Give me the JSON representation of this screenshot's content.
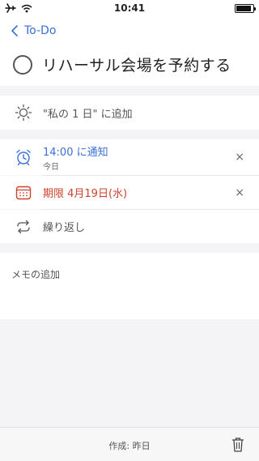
{
  "status_bar": {
    "time": "10:41"
  },
  "header": {
    "back_label": "To-Do"
  },
  "task": {
    "title": "リハーサル会場を予約する"
  },
  "my_day": {
    "label": "\"私の 1 日\" に追加"
  },
  "reminder": {
    "title": "14:00 に通知",
    "subtitle": "今日",
    "color": "#3a6fd8"
  },
  "due": {
    "title": "期限 4月19日(水)",
    "color": "#d0412b"
  },
  "repeat": {
    "label": "繰り返し"
  },
  "notes": {
    "placeholder": "メモの追加"
  },
  "footer": {
    "created": "作成: 昨日"
  },
  "icons": {
    "close": "×"
  }
}
